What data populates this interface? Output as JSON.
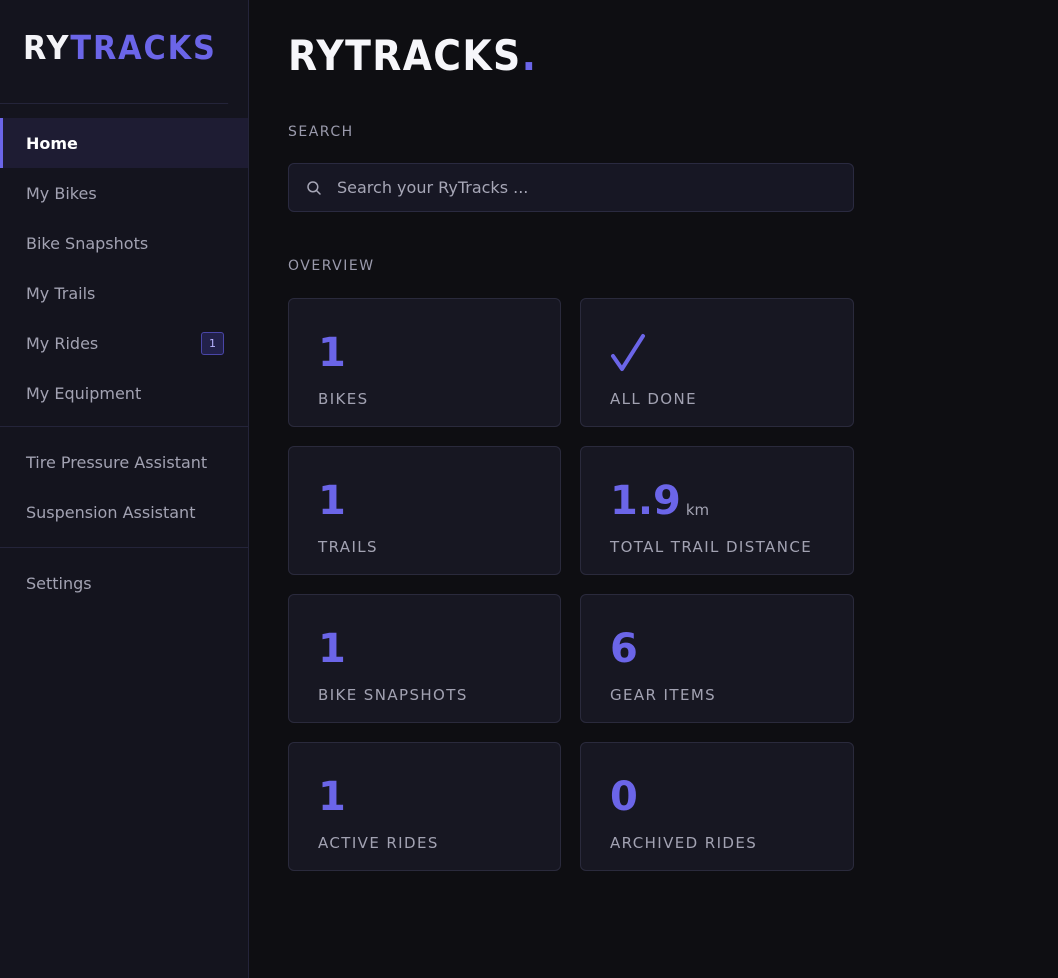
{
  "brand": {
    "part1": "RY",
    "part2": "TRACKS"
  },
  "sidebar": {
    "groups": [
      [
        {
          "label": "Home",
          "active": true
        },
        {
          "label": "My Bikes"
        },
        {
          "label": "Bike Snapshots"
        },
        {
          "label": "My Trails"
        },
        {
          "label": "My Rides",
          "badge": "1"
        },
        {
          "label": "My Equipment"
        }
      ],
      [
        {
          "label": "Tire Pressure Assistant"
        },
        {
          "label": "Suspension Assistant"
        }
      ],
      [
        {
          "label": "Settings"
        }
      ]
    ]
  },
  "main": {
    "title": "RYTRACKS",
    "title_dot": ".",
    "search_label": "SEARCH",
    "search_placeholder": "Search your RyTracks ...",
    "overview_label": "OVERVIEW",
    "cards": [
      {
        "value": "1",
        "label": "BIKES"
      },
      {
        "value": "",
        "icon": "check-icon",
        "label": "ALL DONE"
      },
      {
        "value": "1",
        "label": "TRAILS"
      },
      {
        "value": "1.9",
        "unit": "km",
        "label": "TOTAL TRAIL DISTANCE"
      },
      {
        "value": "1",
        "label": "BIKE SNAPSHOTS"
      },
      {
        "value": "6",
        "label": "GEAR ITEMS"
      },
      {
        "value": "1",
        "label": "ACTIVE RIDES"
      },
      {
        "value": "0",
        "label": "ARCHIVED RIDES"
      }
    ]
  },
  "colors": {
    "accent": "#6b65e8",
    "background": "#0e0e12",
    "sidebar": "#14141e"
  }
}
